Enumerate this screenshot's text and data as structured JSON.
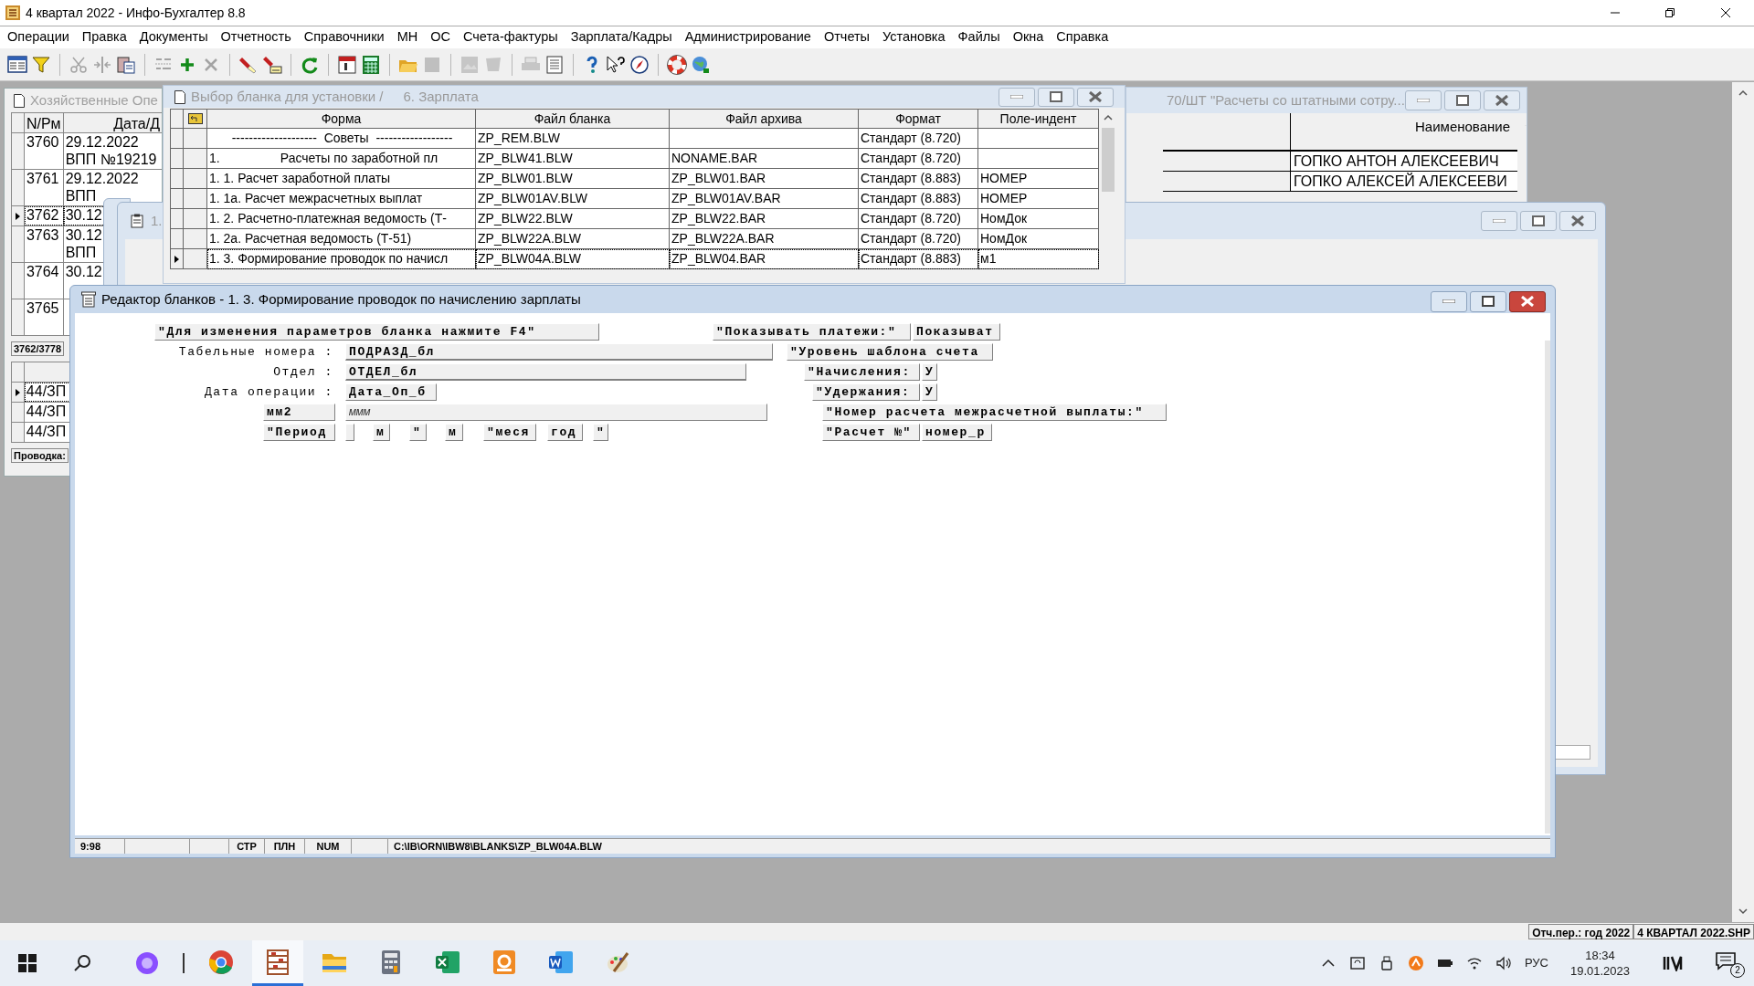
{
  "window": {
    "title": "4 квартал 2022 - Инфо-Бухгалтер 8.8"
  },
  "menu": [
    "Операции",
    "Правка",
    "Документы",
    "Отчетность",
    "Справочники",
    "МН",
    "ОС",
    "Счета-фактуры",
    "Зарплата/Кадры",
    "Администрирование",
    "Отчеты",
    "Установка",
    "Файлы",
    "Окна",
    "Справка"
  ],
  "toolbar": [
    {
      "disabled": false
    },
    {
      "disabled": false
    },
    {
      "disabled": true
    },
    {
      "disabled": true
    },
    {
      "disabled": false
    },
    {
      "disabled": true
    },
    {
      "disabled": false
    },
    {
      "disabled": true
    },
    {
      "disabled": false
    },
    {
      "disabled": false
    },
    {
      "disabled": false
    },
    {
      "disabled": false
    },
    {
      "disabled": false
    },
    {
      "disabled": false
    },
    {
      "disabled": true
    },
    {
      "disabled": true
    },
    {
      "disabled": true
    },
    {
      "disabled": true
    },
    {
      "disabled": false
    },
    {
      "disabled": false
    },
    {
      "disabled": false
    },
    {
      "disabled": false
    },
    {
      "disabled": false
    },
    {
      "disabled": false
    }
  ],
  "documents_window": {
    "title": "Хозяйственные Опе",
    "columns": [
      "N/Pм",
      "Дата/Д"
    ],
    "rows": [
      {
        "number": "3760",
        "lines": [
          "29.12.2022",
          "ВПП №19219"
        ],
        "selected": false
      },
      {
        "number": "3761",
        "lines": [
          "29.12.2022",
          "ВПП"
        ],
        "selected": false
      },
      {
        "number": "3762",
        "lines": [
          "30.12"
        ],
        "selected": true
      },
      {
        "number": "3763",
        "lines": [
          "30.12",
          "ВПП"
        ],
        "selected": false
      },
      {
        "number": "3764",
        "lines": [
          "30.12"
        ],
        "selected": false
      },
      {
        "number": "3765",
        "selected": false
      }
    ],
    "position": "3762/3778",
    "entries": [
      {
        "account": "44/ЗП",
        "selected": true
      },
      {
        "account": "44/ЗП",
        "selected": false
      },
      {
        "account": "44/ЗП",
        "selected": false
      }
    ],
    "footer": "Проводка:"
  },
  "back_window": {
    "title": "1."
  },
  "staff_window": {
    "title": "70/ШТ \"Расчеты со штатными сотру...",
    "column": "Наименование",
    "rows": [
      "ГОПКО АНТОН АЛЕКСЕЕВИЧ",
      "ГОПКО АЛЕКСЕЙ АЛЕКСЕЕВИ"
    ]
  },
  "select_window": {
    "title": "Выбор бланка для установки /",
    "subtitle": "6. Зарплата",
    "columns": [
      "Форма",
      "Файл бланка",
      "Файл архива",
      "Формат",
      "Поле-индент"
    ],
    "rows": [
      {
        "form": "--------------------  Советы  ------------------",
        "blank_file": "ZP_REM.BLW",
        "format": "Стандарт (8.720)",
        "selected": false
      },
      {
        "form": "1.                 Расчеты по заработной пл",
        "blank_file": "ZP_BLW41.BLW",
        "archive_file": "NONAME.BAR",
        "format": "Стандарт (8.720)",
        "selected": false
      },
      {
        "form": "1. 1. Расчет заработной платы",
        "blank_file": "ZP_BLW01.BLW",
        "archive_file": "ZP_BLW01.BAR",
        "format": "Стандарт (8.883)",
        "index_field": "НОМЕР",
        "selected": false
      },
      {
        "form": "1. 1а. Расчет межрасчетных выплат",
        "blank_file": "ZP_BLW01AV.BLW",
        "archive_file": "ZP_BLW01AV.BAR",
        "format": "Стандарт (8.883)",
        "index_field": "НОМЕР",
        "selected": false
      },
      {
        "form": "1. 2. Расчетно-платежная ведомость (Т-",
        "blank_file": "ZP_BLW22.BLW",
        "archive_file": "ZP_BLW22.BAR",
        "format": "Стандарт (8.720)",
        "index_field": "НомДок",
        "selected": false
      },
      {
        "form": "1. 2а. Расчетная ведомость (Т-51)",
        "blank_file": "ZP_BLW22A.BLW",
        "archive_file": "ZP_BLW22A.BAR",
        "format": "Стандарт (8.720)",
        "index_field": "НомДок",
        "selected": false
      },
      {
        "form": "1. 3. Формирование проводок по начисл",
        "blank_file": "ZP_BLW04A.BLW",
        "archive_file": "ZP_BLW04.BAR",
        "format": "Стандарт (8.883)",
        "index_field": "м1",
        "selected": true
      }
    ]
  },
  "editor": {
    "title": "Редактор бланков - 1. 3. Формирование проводок по начислению зарплаты",
    "items": [
      {
        "kind": "box",
        "text": "\"Для изменения параметров бланка нажмите F4\""
      },
      {
        "kind": "box",
        "text": "\"Показывать платежи:\""
      },
      {
        "kind": "box",
        "text": "Показыват"
      },
      {
        "kind": "label",
        "text": "Табельные номера :"
      },
      {
        "kind": "field",
        "text": "ПОДРАЗД_бл"
      },
      {
        "kind": "box",
        "text": "\"Уровень шаблона счета"
      },
      {
        "kind": "label",
        "text": "Отдел :"
      },
      {
        "kind": "field",
        "text": "ОТДЕЛ_бл"
      },
      {
        "kind": "box",
        "text": "\"Начисления:"
      },
      {
        "kind": "box",
        "text": "У"
      },
      {
        "kind": "label",
        "text": "Дата операции :"
      },
      {
        "kind": "box",
        "text": "Дата_Оп_б"
      },
      {
        "kind": "box",
        "text": "\"Удержания:"
      },
      {
        "kind": "box",
        "text": "У"
      },
      {
        "kind": "box",
        "text": "мм2"
      },
      {
        "kind": "expr",
        "text": "ммм"
      },
      {
        "kind": "box",
        "text": "\"Номер расчета межрасчетной выплаты:\""
      },
      {
        "kind": "box",
        "text": "\"Период"
      },
      {
        "kind": "blank"
      },
      {
        "kind": "box",
        "text": "м"
      },
      {
        "kind": "box",
        "text": "\""
      },
      {
        "kind": "box",
        "text": "м"
      },
      {
        "kind": "box",
        "text": "\"меся"
      },
      {
        "kind": "box",
        "text": "год"
      },
      {
        "kind": "box",
        "text": "\""
      },
      {
        "kind": "box",
        "text": "\"Расчет №\""
      },
      {
        "kind": "box",
        "text": "номер_р"
      }
    ],
    "status": [
      "9:98",
      "СТР",
      "ПЛН",
      "NUM",
      "C:\\IB\\ORN\\IBW8\\BLANKS\\ZP_BLW04A.BLW"
    ]
  },
  "period_info": [
    "Отч.пер.: год 2022",
    "4 КВАРТАЛ 2022.SHP"
  ],
  "taskbar_apps": [
    {
      "active": false
    },
    {
      "active": true
    },
    {
      "active": false
    },
    {
      "active": false
    },
    {
      "active": false
    },
    {
      "active": false
    },
    {
      "active": false
    },
    {
      "active": false
    }
  ],
  "tray": {
    "language": "РУС",
    "time": "18:34",
    "date": "19.01.2023",
    "notifications": "2"
  }
}
